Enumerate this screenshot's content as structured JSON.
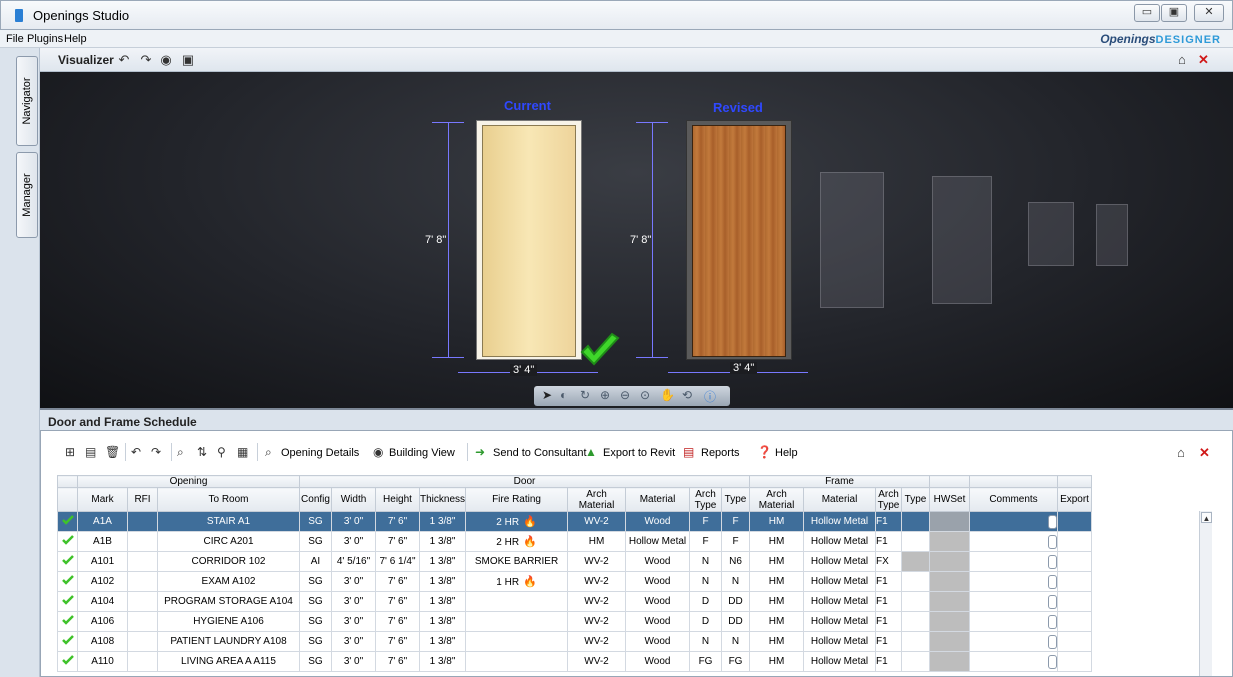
{
  "window": {
    "title": "Openings Studio"
  },
  "menu": {
    "items": [
      "File",
      "Plugins",
      "Help"
    ],
    "brand_main": "Openings",
    "brand_accent": "DESIGNER"
  },
  "sidebar": {
    "tabs": [
      "Navigator",
      "Manager"
    ]
  },
  "visualizer": {
    "title": "Visualizer",
    "current_label": "Current",
    "revised_label": "Revised",
    "height_current": "7' 8\"",
    "height_revised": "7' 8\"",
    "width_current": "3' 4\"",
    "width_revised": "3' 4\""
  },
  "schedule": {
    "title": "Door and Frame Schedule",
    "toolbar": {
      "opening_details": "Opening Details",
      "building_view": "Building View",
      "send_to_consultant": "Send to Consultant",
      "export_to_revit": "Export to Revit",
      "reports": "Reports",
      "help": "Help"
    },
    "group_headers": {
      "opening": "Opening",
      "door": "Door",
      "frame": "Frame"
    },
    "columns": {
      "mark": "Mark",
      "rfi": "RFI",
      "to_room": "To Room",
      "config": "Config",
      "width": "Width",
      "height": "Height",
      "thickness": "Thickness",
      "fire_rating": "Fire Rating",
      "door_arch_material": "Arch Material",
      "door_material": "Material",
      "door_arch_type": "Arch Type",
      "door_type": "Type",
      "frame_arch_material": "Arch Material",
      "frame_material": "Material",
      "frame_arch_type": "Arch Type",
      "frame_type": "Type",
      "hwset": "HWSet",
      "comments": "Comments",
      "export": "Export"
    },
    "rows": [
      {
        "mark": "A1A",
        "rfi": "",
        "room": "STAIR A1",
        "config": "SG",
        "width": "3' 0\"",
        "height": "7' 6\"",
        "thickness": "1 3/8\"",
        "fire": "2 HR",
        "fire_icon": true,
        "d_arch_mat": "WV-2",
        "d_mat": "Wood",
        "d_arch_type": "F",
        "d_type": "F",
        "f_arch_mat": "HM",
        "f_mat": "Hollow Metal",
        "f_arch_type": "F1",
        "f_type": ""
      },
      {
        "mark": "A1B",
        "rfi": "",
        "room": "CIRC A201",
        "config": "SG",
        "width": "3' 0\"",
        "height": "7' 6\"",
        "thickness": "1 3/8\"",
        "fire": "2 HR",
        "fire_icon": true,
        "d_arch_mat": "HM",
        "d_mat": "Hollow Metal",
        "d_arch_type": "F",
        "d_type": "F",
        "f_arch_mat": "HM",
        "f_mat": "Hollow Metal",
        "f_arch_type": "F1",
        "f_type": ""
      },
      {
        "mark": "A101",
        "rfi": "",
        "room": "CORRIDOR 102",
        "config": "AI",
        "width": "4' 5/16\"",
        "height": "7' 6 1/4\"",
        "thickness": "1 3/8\"",
        "fire": "SMOKE BARRIER",
        "fire_icon": false,
        "d_arch_mat": "WV-2",
        "d_mat": "Wood",
        "d_arch_type": "N",
        "d_type": "N6",
        "f_arch_mat": "HM",
        "f_mat": "Hollow Metal",
        "f_arch_type": "FX",
        "f_type": ""
      },
      {
        "mark": "A102",
        "rfi": "",
        "room": "EXAM A102",
        "config": "SG",
        "width": "3' 0\"",
        "height": "7' 6\"",
        "thickness": "1 3/8\"",
        "fire": "1 HR",
        "fire_icon": true,
        "d_arch_mat": "WV-2",
        "d_mat": "Wood",
        "d_arch_type": "N",
        "d_type": "N",
        "f_arch_mat": "HM",
        "f_mat": "Hollow Metal",
        "f_arch_type": "F1",
        "f_type": ""
      },
      {
        "mark": "A104",
        "rfi": "",
        "room": "PROGRAM STORAGE A104",
        "config": "SG",
        "width": "3' 0\"",
        "height": "7' 6\"",
        "thickness": "1 3/8\"",
        "fire": "",
        "fire_icon": false,
        "d_arch_mat": "WV-2",
        "d_mat": "Wood",
        "d_arch_type": "D",
        "d_type": "DD",
        "f_arch_mat": "HM",
        "f_mat": "Hollow Metal",
        "f_arch_type": "F1",
        "f_type": ""
      },
      {
        "mark": "A106",
        "rfi": "",
        "room": "HYGIENE A106",
        "config": "SG",
        "width": "3' 0\"",
        "height": "7' 6\"",
        "thickness": "1 3/8\"",
        "fire": "",
        "fire_icon": false,
        "d_arch_mat": "WV-2",
        "d_mat": "Wood",
        "d_arch_type": "D",
        "d_type": "DD",
        "f_arch_mat": "HM",
        "f_mat": "Hollow Metal",
        "f_arch_type": "F1",
        "f_type": ""
      },
      {
        "mark": "A108",
        "rfi": "",
        "room": "PATIENT LAUNDRY A108",
        "config": "SG",
        "width": "3' 0\"",
        "height": "7' 6\"",
        "thickness": "1 3/8\"",
        "fire": "",
        "fire_icon": false,
        "d_arch_mat": "WV-2",
        "d_mat": "Wood",
        "d_arch_type": "N",
        "d_type": "N",
        "f_arch_mat": "HM",
        "f_mat": "Hollow Metal",
        "f_arch_type": "F1",
        "f_type": ""
      },
      {
        "mark": "A110",
        "rfi": "",
        "room": "LIVING AREA A A115",
        "config": "SG",
        "width": "3' 0\"",
        "height": "7' 6\"",
        "thickness": "1 3/8\"",
        "fire": "",
        "fire_icon": false,
        "d_arch_mat": "WV-2",
        "d_mat": "Wood",
        "d_arch_type": "FG",
        "d_type": "FG",
        "f_arch_mat": "HM",
        "f_mat": "Hollow Metal",
        "f_arch_type": "F1",
        "f_type": ""
      }
    ]
  }
}
